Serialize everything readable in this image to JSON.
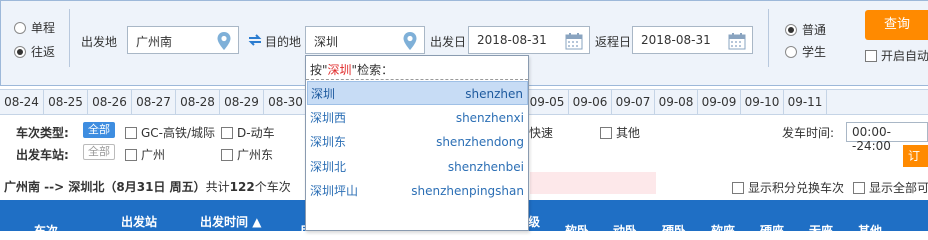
{
  "trip_type": {
    "oneway": "单程",
    "roundtrip": "往返",
    "selected": "roundtrip"
  },
  "from": {
    "label": "出发地",
    "value": "广州南"
  },
  "to": {
    "label": "目的地",
    "value": "深圳"
  },
  "depart": {
    "label": "出发日",
    "value": "2018-08-31"
  },
  "return": {
    "label": "返程日",
    "value": "2018-08-31"
  },
  "passenger": {
    "normal": "普通",
    "student": "学生",
    "selected": "normal"
  },
  "query_button": "查询",
  "auto_option": "开启自动",
  "dates": [
    "08-24",
    "08-25",
    "08-26",
    "08-27",
    "08-28",
    "08-29",
    "08-30",
    "08-31",
    "09-01",
    "09-02",
    "09-03",
    "09-04",
    "09-05",
    "09-06",
    "09-07",
    "09-08",
    "09-09",
    "09-10",
    "09-11"
  ],
  "filters": {
    "train_type_label": "车次类型:",
    "all": "全部",
    "types": [
      "GC-高铁/城际",
      "D-动车",
      "快速",
      "其他"
    ],
    "station_label": "出发车站:",
    "stations": [
      "广州",
      "广州东"
    ],
    "time_label": "发车时间:",
    "time_value": "00:00--24:00",
    "book_button": "订票"
  },
  "result": {
    "route": "广州南 --> 深圳北",
    "date_text": "（8月31日  周五）",
    "count_prefix": "共计",
    "count": "122",
    "count_suffix": "个车次",
    "show_points": "显示积分兑换车次",
    "show_all": "显示全部可"
  },
  "table_header": {
    "train": "车次",
    "from_station": "出发站",
    "depart_time": "出发时间",
    "col_partial_1": "用",
    "col_partial_2": "级",
    "soft_sleeper": "软卧",
    "moving_sleeper": "动卧",
    "hard_sleeper": "硬卧",
    "soft_seat": "软座",
    "hard_seat": "硬座",
    "no_seat": "无座",
    "other": "其他"
  },
  "suggest": {
    "prefix": "按\"",
    "keyword": "深圳",
    "suffix": "\"检索：",
    "items": [
      {
        "name": "深圳",
        "pinyin": "shenzhen"
      },
      {
        "name": "深圳西",
        "pinyin": "shenzhenxi"
      },
      {
        "name": "深圳东",
        "pinyin": "shenzhendong"
      },
      {
        "name": "深圳北",
        "pinyin": "shenzhenbei"
      },
      {
        "name": "深圳坪山",
        "pinyin": "shenzhenpingshan"
      }
    ]
  }
}
